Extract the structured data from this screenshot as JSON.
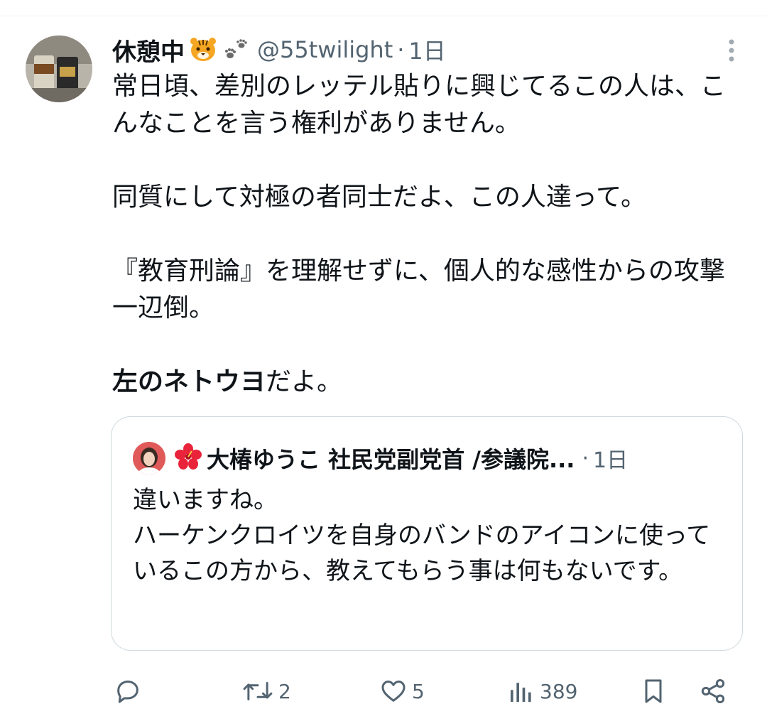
{
  "tweet": {
    "author_name": "休憩中",
    "emoji_icons": [
      "tiger-face-icon",
      "paw-prints-icon"
    ],
    "handle": "@55twilight",
    "separator": "·",
    "time": "1日",
    "text_paragraphs": [
      "常日頃、差別のレッテル貼りに興じてるこの人は、こんなことを言う権利がありません。",
      "同質にして対極の者同士だよ、この人達って。",
      "『教育刑論』を理解せずに、個人的な感性からの攻撃一辺倒。"
    ],
    "last_line_bold": "左のネトウヨ",
    "last_line_rest": "だよ。"
  },
  "quote": {
    "emoji_icon": "hibiscus-icon",
    "author_name": "大椿ゆうこ 社民党副党首 /参議院...",
    "separator": "·",
    "time": "1日",
    "text": "違いますね。\nハーケンクロイツを自身のバンドのアイコンに使っているこの方から、教えてもらう事は何もないです。"
  },
  "actions": {
    "reply_icon": "reply-icon",
    "retweet_icon": "retweet-icon",
    "retweet_count": "2",
    "like_icon": "heart-icon",
    "like_count": "5",
    "views_icon": "views-icon",
    "views_count": "389",
    "bookmark_icon": "bookmark-icon",
    "share_icon": "share-icon"
  },
  "colors": {
    "text_primary": "#0f1419",
    "text_secondary": "#536471",
    "border": "#cfd9de"
  }
}
